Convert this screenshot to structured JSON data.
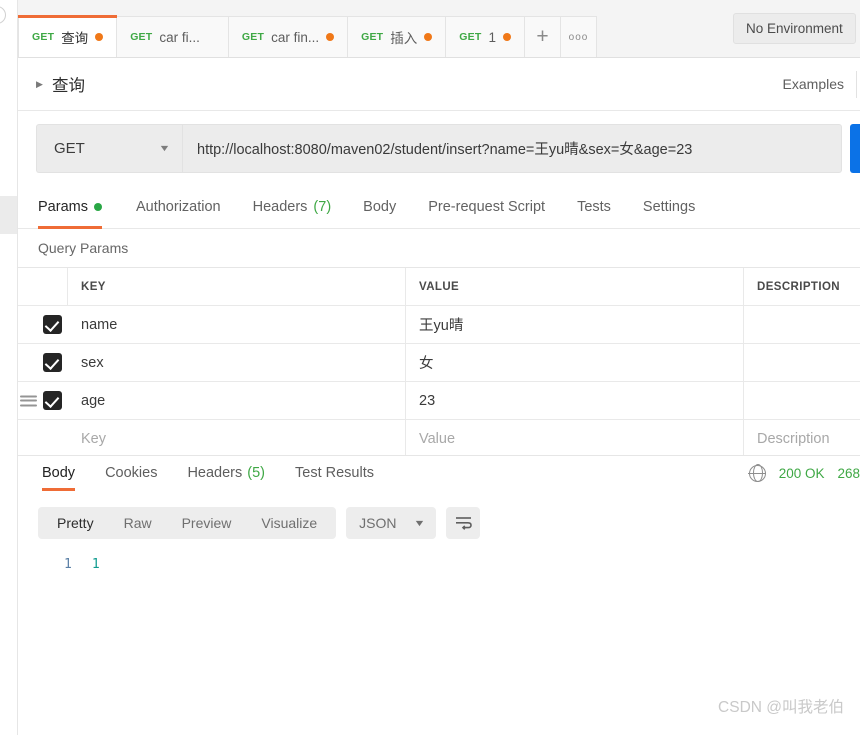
{
  "tabs": [
    {
      "method": "GET",
      "label": "查询",
      "dirty": true,
      "active": true
    },
    {
      "method": "GET",
      "label": "car fi...",
      "dirty": false,
      "active": false
    },
    {
      "method": "GET",
      "label": "car fin...",
      "dirty": true,
      "active": false
    },
    {
      "method": "GET",
      "label": "插入",
      "dirty": true,
      "active": false
    },
    {
      "method": "GET",
      "label": "1",
      "dirty": true,
      "active": false
    }
  ],
  "tabbar": {
    "new_tab_icon": "plus-icon",
    "more_icon": "ellipsis-icon"
  },
  "environment": {
    "selected": "No Environment"
  },
  "request": {
    "caret_icon": "chevron-right-icon",
    "title": "查询",
    "examples_label": "Examples",
    "method": "GET",
    "method_caret_icon": "chevron-down-icon",
    "url": "http://localhost:8080/maven02/student/insert?name=王yu晴&sex=女&age=23",
    "send_label": ""
  },
  "request_tabs": [
    {
      "label": "Params",
      "badge": "dot",
      "active": true
    },
    {
      "label": "Authorization",
      "badge": "",
      "active": false
    },
    {
      "label": "Headers",
      "badge": "(7)",
      "active": false
    },
    {
      "label": "Body",
      "badge": "",
      "active": false
    },
    {
      "label": "Pre-request Script",
      "badge": "",
      "active": false
    },
    {
      "label": "Tests",
      "badge": "",
      "active": false
    },
    {
      "label": "Settings",
      "badge": "",
      "active": false
    }
  ],
  "params": {
    "section_title": "Query Params",
    "columns": {
      "key": "KEY",
      "value": "VALUE",
      "description": "DESCRIPTION"
    },
    "rows": [
      {
        "checked": true,
        "key": "name",
        "value": "王yu晴",
        "description": "",
        "handle": false
      },
      {
        "checked": true,
        "key": "sex",
        "value": "女",
        "description": "",
        "handle": false
      },
      {
        "checked": true,
        "key": "age",
        "value": "23",
        "description": "",
        "handle": true
      }
    ],
    "placeholder_row": {
      "key": "Key",
      "value": "Value",
      "description": "Description"
    }
  },
  "response_tabs": [
    {
      "label": "Body",
      "badge": "",
      "active": true
    },
    {
      "label": "Cookies",
      "badge": "",
      "active": false
    },
    {
      "label": "Headers",
      "badge": "(5)",
      "active": false
    },
    {
      "label": "Test Results",
      "badge": "",
      "active": false
    }
  ],
  "response_status": {
    "globe_icon": "globe-icon",
    "status": "200 OK",
    "time": "268"
  },
  "response_toolbar": {
    "views": [
      {
        "label": "Pretty",
        "active": true
      },
      {
        "label": "Raw",
        "active": false
      },
      {
        "label": "Preview",
        "active": false
      },
      {
        "label": "Visualize",
        "active": false
      }
    ],
    "format": "JSON",
    "format_caret_icon": "chevron-down-icon",
    "wrap_icon": "wrap-lines-icon"
  },
  "response_body": {
    "lines": [
      {
        "number": "1",
        "content": "1"
      }
    ]
  },
  "watermark": "CSDN @叫我老伯",
  "colors": {
    "accent": "#ef6c36",
    "method_green": "#3fa845",
    "dirty_dot": "#f07818",
    "send_blue": "#0b72e7",
    "status_green": "#3fa845",
    "json_number": "#0f9b8e",
    "line_number": "#5a7fa6"
  }
}
